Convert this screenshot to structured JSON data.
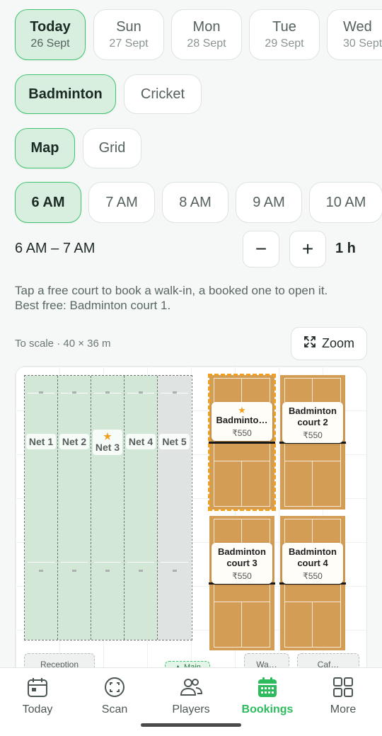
{
  "dates": [
    {
      "day": "Today",
      "date": "26 Sept"
    },
    {
      "day": "Sun",
      "date": "27 Sept"
    },
    {
      "day": "Mon",
      "date": "28 Sept"
    },
    {
      "day": "Tue",
      "date": "29 Sept"
    },
    {
      "day": "Wed",
      "date": "30 Sept"
    }
  ],
  "sports": [
    "Badminton",
    "Cricket"
  ],
  "views": [
    "Map",
    "Grid"
  ],
  "times": [
    "6 AM",
    "7 AM",
    "8 AM",
    "9 AM",
    "10 AM"
  ],
  "slot": {
    "range": "6 AM – 7 AM",
    "minus": "−",
    "plus": "+",
    "duration": "1 h"
  },
  "hint": {
    "line1": "Tap a free court to book a walk-in, a booked one to open it.",
    "line2": "Best free: Badminton court 1."
  },
  "map": {
    "scale": "To scale · 40 × 36 m",
    "zoom_label": "Zoom",
    "nets": [
      "Net 1",
      "Net 2",
      "Net 3",
      "Net 4",
      "Net 5"
    ],
    "star": "★",
    "courts": [
      {
        "name": "Badminton court 1",
        "short": "Badminto…",
        "price": "₹550"
      },
      {
        "name": "Badminton court 2",
        "line1": "Badminton",
        "line2": "court 2",
        "price": "₹550"
      },
      {
        "name": "Badminton court 3",
        "line1": "Badminton",
        "line2": "court 3",
        "price": "₹550"
      },
      {
        "name": "Badminton court 4",
        "line1": "Badminton",
        "line2": "court 4",
        "price": "₹550"
      }
    ],
    "facilities": [
      "Reception",
      "▲ Main",
      "Wa…",
      "Caf…"
    ]
  },
  "tabs": [
    "Today",
    "Scan",
    "Players",
    "Bookings",
    "More"
  ],
  "colors": {
    "accent": "#2dbb5d",
    "selected_bg": "#d8efe0",
    "court": "#d49d55",
    "net_free": "#d2e7d6",
    "net_blocked": "#dfe3e1",
    "best_outline": "#f0a020"
  }
}
